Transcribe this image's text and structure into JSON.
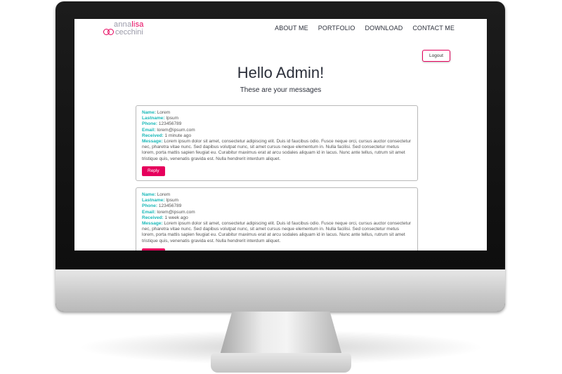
{
  "site": {
    "logo": {
      "line1_a": "anna",
      "line1_b": "lisa",
      "line2": "cecchini"
    },
    "nav": [
      "ABOUT ME",
      "PORTFOLIO",
      "DOWNLOAD",
      "CONTACT ME"
    ],
    "logout_label": "Logout"
  },
  "page": {
    "title": "Hello Admin!",
    "subtitle": "These are your messages"
  },
  "labels": {
    "name": "Name:",
    "lastname": "Lastname:",
    "phone": "Phone:",
    "email": "Email:",
    "received": "Received:",
    "message": "Message:",
    "reply": "Reply"
  },
  "messages": [
    {
      "name": "Lorem",
      "lastname": "Ipsum",
      "phone": "123456789",
      "email": "lorem@ipsum.com",
      "received": "1 minute ago",
      "message": "Lorem ipsum dolor sit amet, consectetur adipiscing elit. Duis id faucibus odio. Fusce neque orci, cursus auctor consectetur nec, pharetra vitae nunc. Sed dapibus volutpat nunc, sit amet cursus neque elementum in. Nulla facilisi. Sed consectetur metus lorem, porta mattis sapien feugiat eu. Curabitur maximus erat at arcu sodales aliquam id in lacus. Nunc ante tellus, rutrum sit amet tristique quis, venenatis gravida est. Nulla hendrerit interdum aliquet."
    },
    {
      "name": "Lorem",
      "lastname": "Ipsum",
      "phone": "123456789",
      "email": "lorem@ipsum.com",
      "received": "1 week ago",
      "message": "Lorem ipsum dolor sit amet, consectetur adipiscing elit. Duis id faucibus odio. Fusce neque orci, cursus auctor consectetur nec, pharetra vitae nunc. Sed dapibus volutpat nunc, sit amet cursus neque elementum in. Nulla facilisi. Sed consectetur metus lorem, porta mattis sapien feugiat eu. Curabitur maximus erat at arcu sodales aliquam id in lacus. Nunc ante tellus, rutrum sit amet tristique quis, venenatis gravida est. Nulla hendrerit interdum aliquet."
    }
  ],
  "colors": {
    "accent": "#e6005c",
    "label": "#19b8b8",
    "text": "#2b2f3a"
  }
}
